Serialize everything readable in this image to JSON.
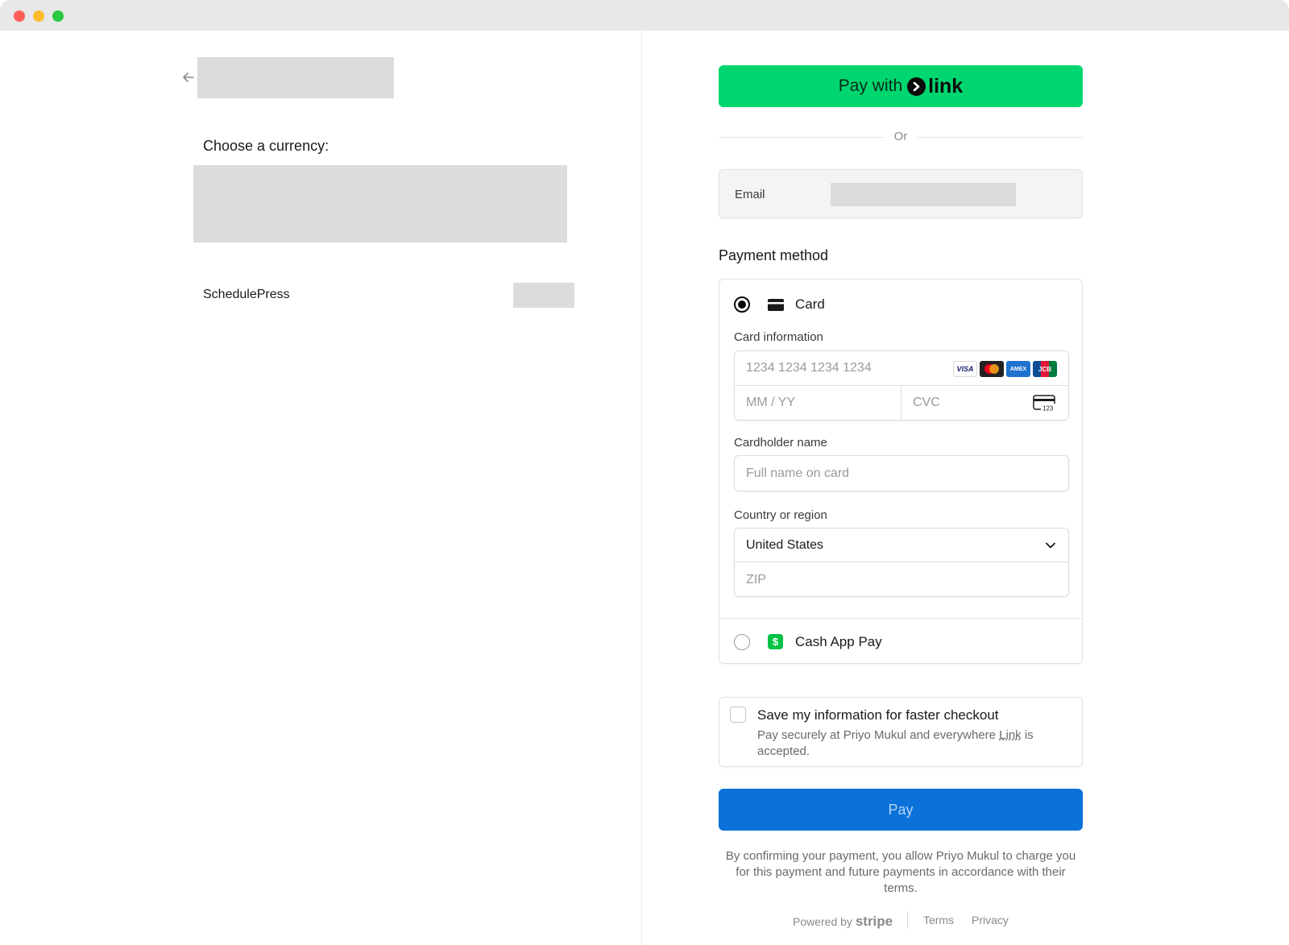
{
  "left": {
    "currency_label": "Choose a currency:",
    "product_name": "SchedulePress"
  },
  "right": {
    "link_button": {
      "prefix": "Pay with",
      "brand": "link"
    },
    "or_text": "Or",
    "email": {
      "label": "Email"
    },
    "payment_method": {
      "title": "Payment method",
      "card": {
        "label": "Card",
        "card_info_label": "Card information",
        "number_placeholder": "1234 1234 1234 1234",
        "expiry_placeholder": "MM / YY",
        "cvc_placeholder": "CVC",
        "cvc_icon_text": "123",
        "brands": [
          "VISA",
          "Mastercard",
          "AMEX",
          "JCB"
        ],
        "cardholder_label": "Cardholder name",
        "cardholder_placeholder": "Full name on card",
        "country_label": "Country or region",
        "country_value": "United States",
        "zip_placeholder": "ZIP"
      },
      "cashapp": {
        "label": "Cash App Pay",
        "icon_text": "$"
      }
    },
    "save_info": {
      "title": "Save my information for faster checkout",
      "desc_prefix": "Pay securely at Priyo Mukul and everywhere",
      "desc_link": "Link",
      "desc_suffix": "is accepted."
    },
    "pay_button": "Pay",
    "legal": "By confirming your payment, you allow Priyo Mukul to charge you for this payment and future payments in accordance with their terms.",
    "footer": {
      "powered_by": "Powered by",
      "stripe": "stripe",
      "terms": "Terms",
      "privacy": "Privacy"
    }
  },
  "colors": {
    "link_green": "#00d66f",
    "pay_blue": "#0a72d9",
    "cashapp_green": "#00c244",
    "redacted_gray": "#dcdcdc"
  },
  "icons": [
    "back-arrow-icon",
    "link-chevron-icon",
    "card-icon",
    "cvc-card-icon",
    "chevron-down-icon",
    "cashapp-icon"
  ]
}
